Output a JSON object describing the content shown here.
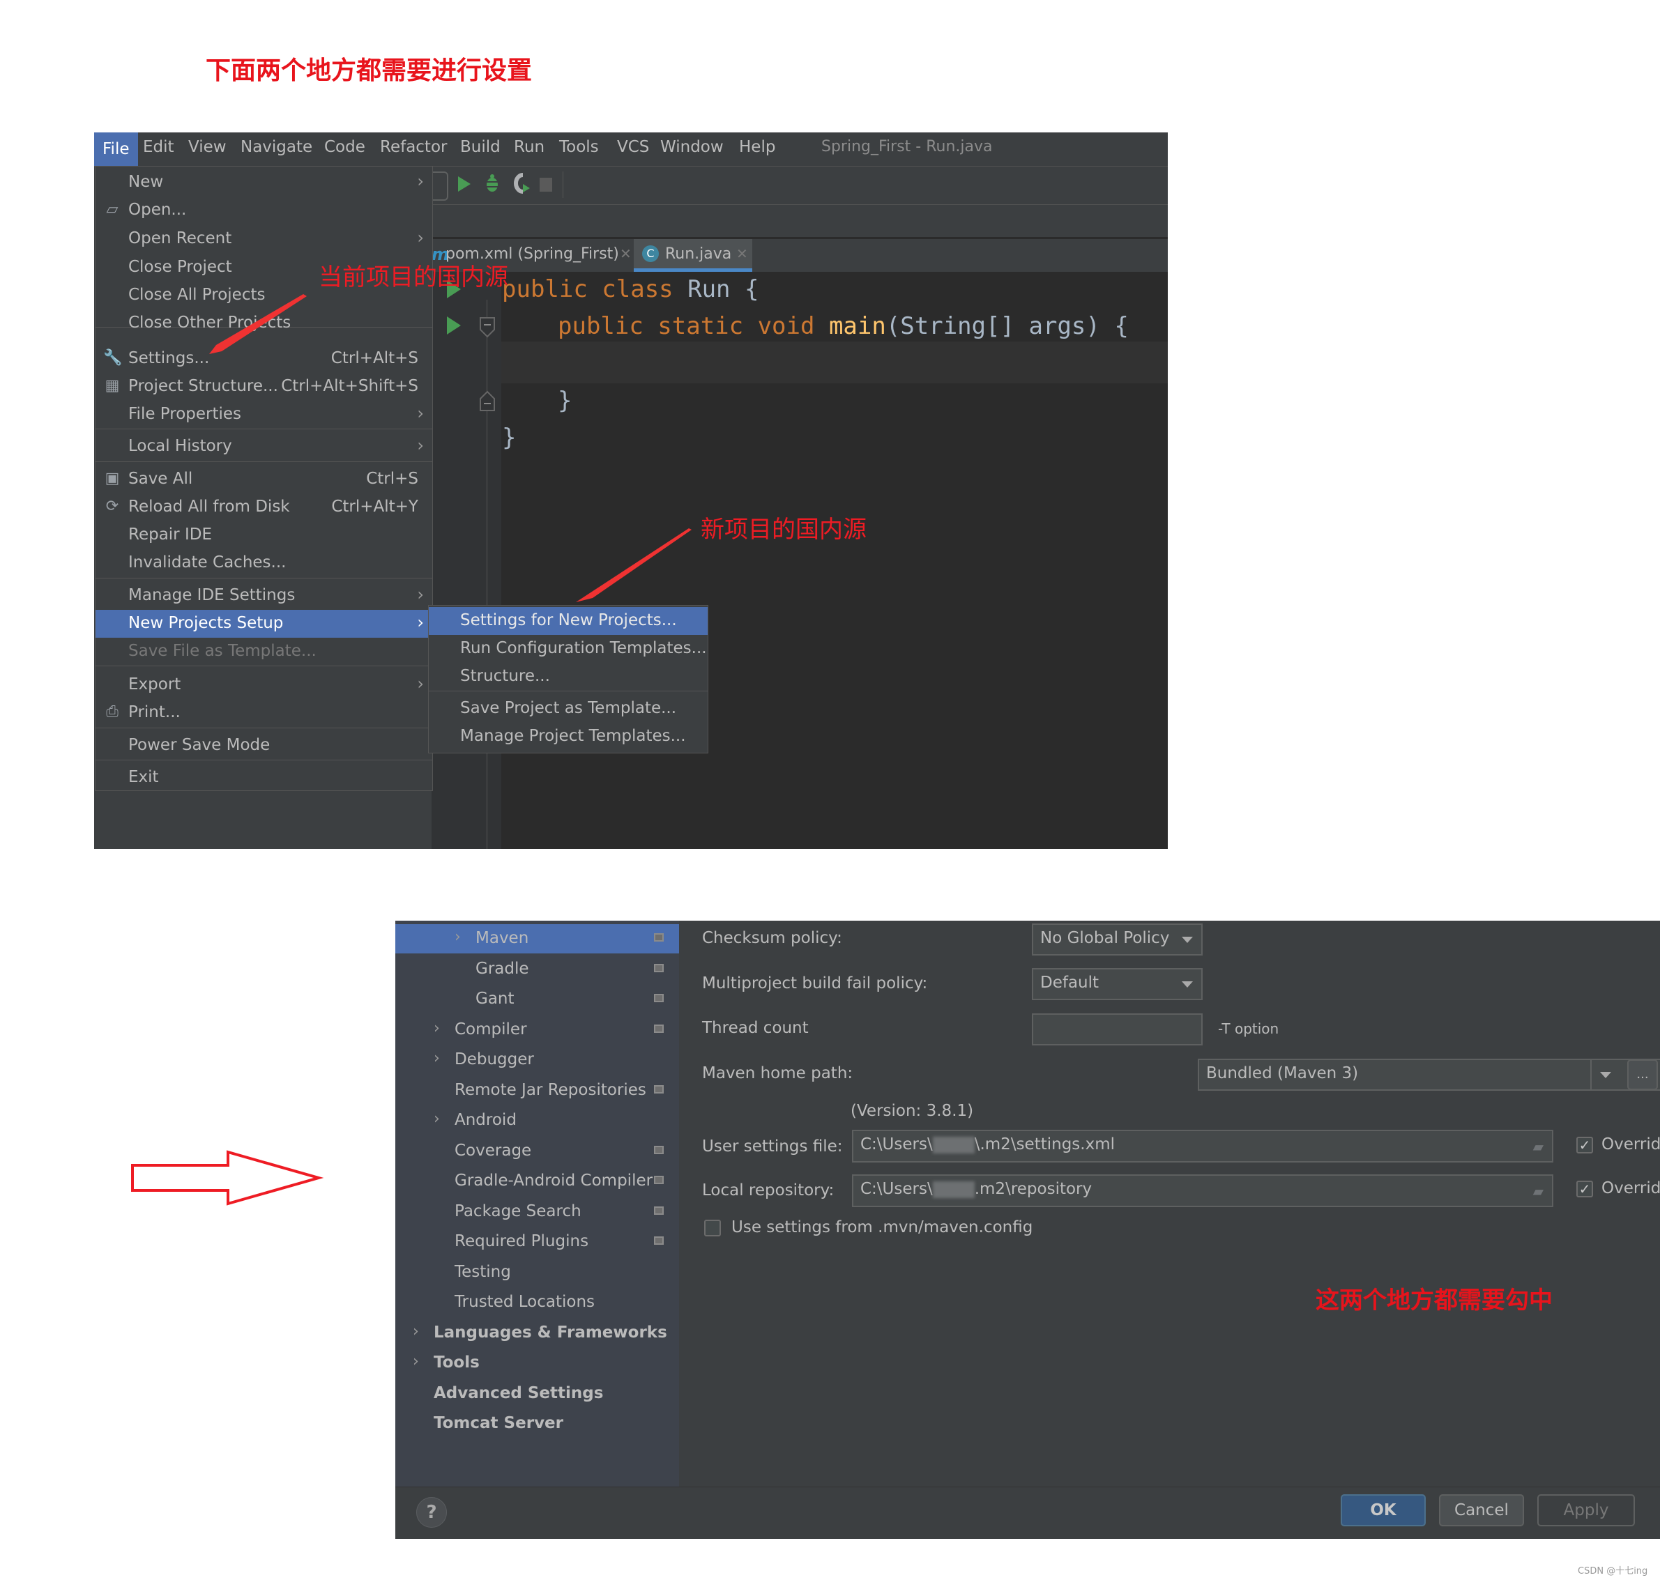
{
  "annotations": {
    "top_title": "下面两个地方都需要进行设置",
    "current_project_note": "当前项目的国内源",
    "new_project_note": "新项目的国内源",
    "check_both_note": "这两个地方都需要勾中",
    "watermark": "CSDN @十七ing"
  },
  "ide": {
    "window_title": "Spring_First - Run.java",
    "menubar": [
      "File",
      "Edit",
      "View",
      "Navigate",
      "Code",
      "Refactor",
      "Build",
      "Run",
      "Tools",
      "VCS",
      "Window",
      "Help"
    ],
    "active_menu": "File",
    "toolbar_icons": [
      "run-icon",
      "debug-icon",
      "coverage-icon",
      "stop-icon"
    ],
    "tabs": [
      {
        "label": "pom.xml (Spring_First)",
        "icon": "maven-icon",
        "active": false
      },
      {
        "label": "Run.java",
        "icon": "java-class-icon",
        "active": true
      }
    ],
    "code": {
      "line1": {
        "kw": "public class ",
        "name": "Run",
        "rest": " {"
      },
      "line2": {
        "kw": "public static void ",
        "fn": "main",
        "rest": "(String[] args) {"
      },
      "line3": "",
      "line4": "}",
      "line5": "}"
    }
  },
  "file_menu": {
    "items": [
      {
        "label": "New",
        "submenu": true
      },
      {
        "label": "Open...",
        "icon": "folder-open-icon"
      },
      {
        "label": "Open Recent",
        "submenu": true
      },
      {
        "label": "Close Project"
      },
      {
        "label": "Close All Projects"
      },
      {
        "label": "Close Other Projects"
      },
      {
        "label": "Settings...",
        "icon": "wrench-icon",
        "shortcut": "Ctrl+Alt+S"
      },
      {
        "label": "Project Structure...",
        "icon": "project-structure-icon",
        "shortcut": "Ctrl+Alt+Shift+S"
      },
      {
        "label": "File Properties",
        "submenu": true
      },
      {
        "label": "Local History",
        "submenu": true
      },
      {
        "label": "Save All",
        "icon": "save-icon",
        "shortcut": "Ctrl+S"
      },
      {
        "label": "Reload All from Disk",
        "icon": "reload-icon",
        "shortcut": "Ctrl+Alt+Y"
      },
      {
        "label": "Repair IDE"
      },
      {
        "label": "Invalidate Caches..."
      },
      {
        "label": "Manage IDE Settings",
        "submenu": true
      },
      {
        "label": "New Projects Setup",
        "submenu": true,
        "selected": true
      },
      {
        "label": "Save File as Template...",
        "disabled": true
      },
      {
        "label": "Export",
        "submenu": true
      },
      {
        "label": "Print...",
        "icon": "print-icon"
      },
      {
        "label": "Power Save Mode"
      },
      {
        "label": "Exit"
      }
    ]
  },
  "new_projects_submenu": {
    "items": [
      {
        "label": "Settings for New Projects...",
        "selected": true
      },
      {
        "label": "Run Configuration Templates..."
      },
      {
        "label": "Structure..."
      },
      {
        "label": "Save Project as Template..."
      },
      {
        "label": "Manage Project Templates..."
      }
    ]
  },
  "settings_dialog": {
    "tree": [
      {
        "label": "Maven",
        "selected": true,
        "expandable": true,
        "project_level": true
      },
      {
        "label": "Gradle",
        "project_level": true
      },
      {
        "label": "Gant",
        "project_level": true
      },
      {
        "label": "Compiler",
        "expandable": true,
        "project_level": true
      },
      {
        "label": "Debugger",
        "expandable": true
      },
      {
        "label": "Remote Jar Repositories",
        "project_level": true
      },
      {
        "label": "Android",
        "expandable": true
      },
      {
        "label": "Coverage",
        "project_level": true
      },
      {
        "label": "Gradle-Android Compiler",
        "project_level": true
      },
      {
        "label": "Package Search",
        "project_level": true
      },
      {
        "label": "Required Plugins",
        "project_level": true
      },
      {
        "label": "Testing"
      },
      {
        "label": "Trusted Locations"
      },
      {
        "label": "Languages & Frameworks",
        "expandable": true,
        "bold": true
      },
      {
        "label": "Tools",
        "expandable": true,
        "bold": true
      },
      {
        "label": "Advanced Settings",
        "bold": true
      },
      {
        "label": "Tomcat Server",
        "bold": true
      }
    ],
    "fields": {
      "checksum_policy_label": "Checksum policy:",
      "checksum_policy_value": "No Global Policy",
      "fail_policy_label": "Multiproject build fail policy:",
      "fail_policy_value": "Default",
      "thread_count_label": "Thread count",
      "thread_count_value": "",
      "thread_count_hint": "-T option",
      "maven_home_label": "Maven home path:",
      "maven_home_value": "Bundled (Maven 3)",
      "maven_version": "(Version: 3.8.1)",
      "browse_label": "...",
      "user_settings_label": "User settings file:",
      "user_settings_prefix": "C:\\Users\\",
      "user_settings_suffix": "\\.m2\\settings.xml",
      "user_settings_override": true,
      "local_repo_label": "Local repository:",
      "local_repo_prefix": "C:\\Users\\",
      "local_repo_suffix": ".m2\\repository",
      "local_repo_override": true,
      "override_label": "Override",
      "mvn_config_label": "Use settings from .mvn/maven.config",
      "mvn_config_checked": false
    },
    "buttons": {
      "ok": "OK",
      "cancel": "Cancel",
      "apply": "Apply",
      "help": "?"
    }
  }
}
